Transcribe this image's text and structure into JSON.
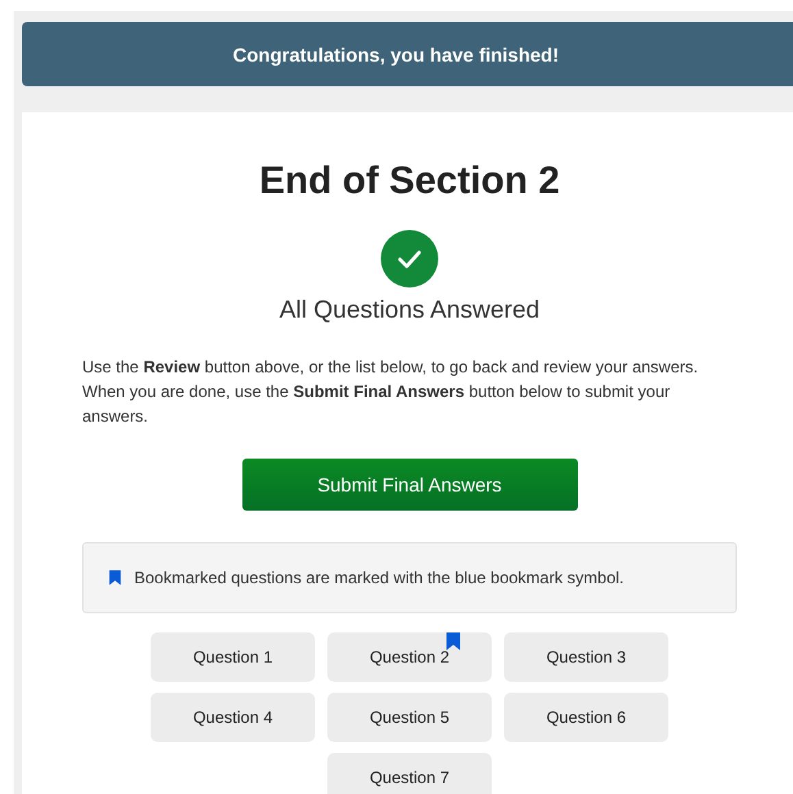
{
  "banner": {
    "text": "Congratulations, you have finished!"
  },
  "section": {
    "title": "End of Section 2",
    "status": "All Questions Answered",
    "complete": true
  },
  "instructions": "Use the **Review** button above, or the list below, to go back and review your answers. When you are done, use the **Submit Final Answers** button below to submit your answers.",
  "submit_button": "Submit Final Answers",
  "info_note": "Bookmarked questions are marked with the blue bookmark symbol.",
  "questions": [
    {
      "label": "Question 1",
      "bookmarked": false
    },
    {
      "label": "Question 2",
      "bookmarked": true
    },
    {
      "label": "Question 3",
      "bookmarked": false
    },
    {
      "label": "Question 4",
      "bookmarked": false
    },
    {
      "label": "Question 5",
      "bookmarked": false
    },
    {
      "label": "Question 6",
      "bookmarked": false
    },
    {
      "label": "Question 7",
      "bookmarked": false
    }
  ]
}
